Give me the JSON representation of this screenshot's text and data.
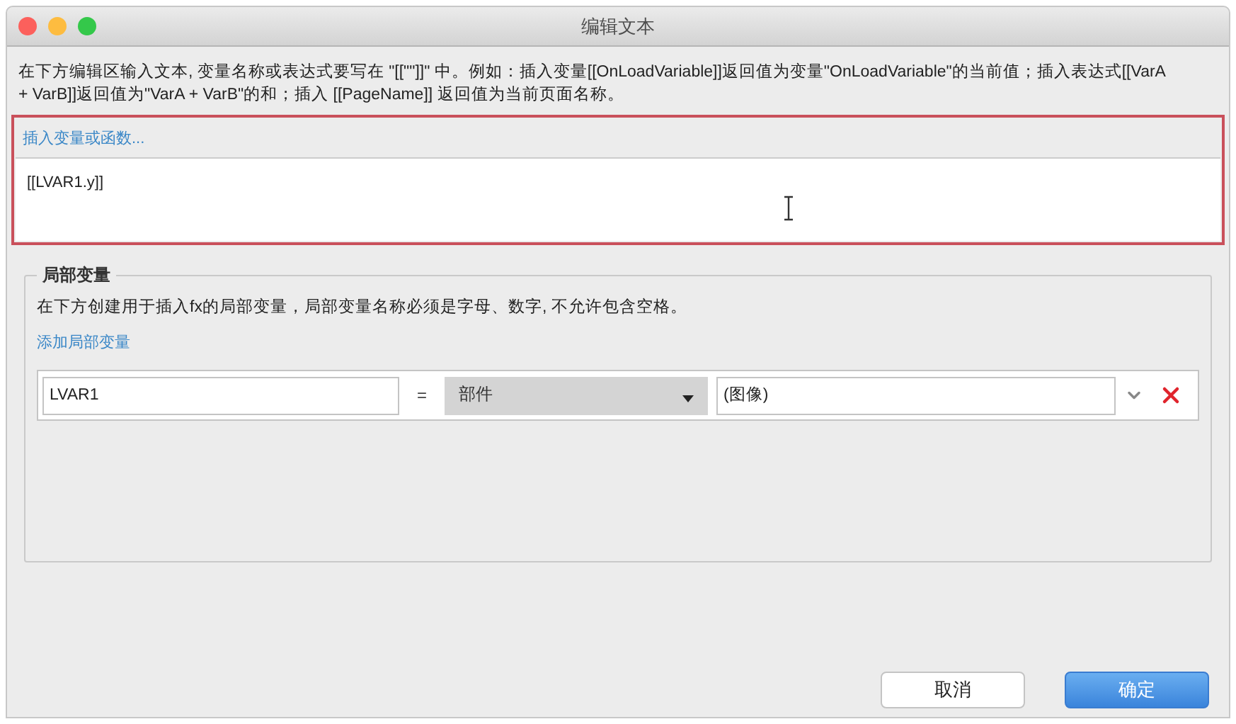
{
  "window": {
    "title": "编辑文本"
  },
  "description": "在下方编辑区输入文本, 变量名称或表达式要写在 \"[[\"\"]]\" 中。例如：插入变量[[OnLoadVariable]]返回值为变量\"OnLoadVariable\"的当前值；插入表达式[[VarA + VarB]]返回值为\"VarA + VarB\"的和；插入 [[PageName]] 返回值为当前页面名称。",
  "editor": {
    "insert_link": "插入变量或函数...",
    "value": "[[LVAR1.y]]"
  },
  "local_variables": {
    "legend": "局部变量",
    "hint": "在下方创建用于插入fx的局部变量，局部变量名称必须是字母、数字, 不允许包含空格。",
    "add_link": "添加局部变量",
    "rows": [
      {
        "name": "LVAR1",
        "operator": "=",
        "type": "部件",
        "target": "(图像)"
      }
    ]
  },
  "buttons": [
    {
      "label": "取消",
      "kind": "secondary"
    },
    {
      "label": "确定",
      "kind": "primary"
    }
  ]
}
